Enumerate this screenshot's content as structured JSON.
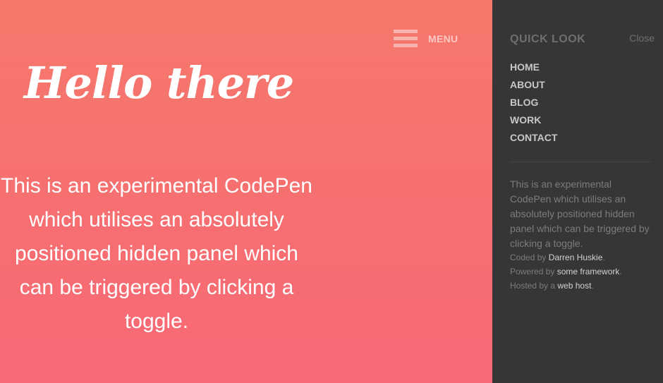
{
  "menu": {
    "label": "MENU",
    "icon": "hamburger-icon"
  },
  "hero": {
    "title": "Hello there",
    "text": "This is an experimental CodePen which utilises an absolutely positioned hidden panel which can be triggered by clicking a toggle."
  },
  "panel": {
    "title": "QUICK LOOK",
    "close_label": "Close",
    "nav": [
      "HOME",
      "ABOUT",
      "BLOG",
      "WORK",
      "CONTACT"
    ],
    "description": "This is an experimental CodePen which utilises an absolutely positioned hidden panel which can be triggered by clicking a toggle.",
    "credits": {
      "coded_prefix": "Coded by ",
      "coded_link": "Darren Huskie",
      "powered_prefix": "Powered by ",
      "powered_link": "some framework",
      "hosted_prefix": "Hosted by a ",
      "hosted_link": "web host",
      "period": "."
    }
  },
  "colors": {
    "gradient_top": "#f5786b",
    "gradient_bottom": "#f86876",
    "panel_bg": "#363636"
  }
}
